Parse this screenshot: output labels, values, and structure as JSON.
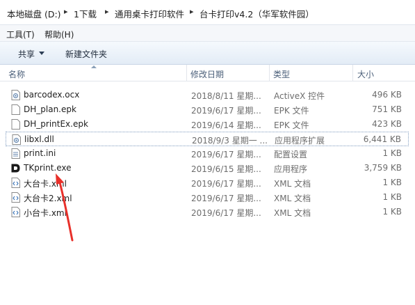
{
  "breadcrumb": [
    "本地磁盘 (D:)",
    "1下载",
    "通用桌卡打印软件",
    "台卡打印v4.2（华军软件园）"
  ],
  "menu": [
    "工具(T)",
    "帮助(H)"
  ],
  "toolbar": {
    "share_label": "共享",
    "new_folder_label": "新建文件夹"
  },
  "columns": {
    "name": "名称",
    "date": "修改日期",
    "type": "类型",
    "size": "大小"
  },
  "files": [
    {
      "icon": "settings-file-icon",
      "name": "barcodex.ocx",
      "date": "2018/8/11 星期...",
      "type": "ActiveX 控件",
      "size": "496 KB"
    },
    {
      "icon": "blank-file-icon",
      "name": "DH_plan.epk",
      "date": "2019/6/17 星期...",
      "type": "EPK 文件",
      "size": "751 KB"
    },
    {
      "icon": "blank-file-icon",
      "name": "DH_printEx.epk",
      "date": "2019/6/14 星期...",
      "type": "EPK 文件",
      "size": "423 KB"
    },
    {
      "icon": "settings-file-icon",
      "name": "libxl.dll",
      "date": "2018/9/3 星期一 ...",
      "type": "应用程序扩展",
      "size": "6,441 KB"
    },
    {
      "icon": "ini-file-icon",
      "name": "print.ini",
      "date": "2019/6/17 星期...",
      "type": "配置设置",
      "size": "1 KB"
    },
    {
      "icon": "app-d-logo-icon",
      "name": "TKprint.exe",
      "date": "2019/6/15 星期...",
      "type": "应用程序",
      "size": "3,759 KB"
    },
    {
      "icon": "xml-file-icon",
      "name": "大台卡.xml",
      "date": "2019/6/17 星期...",
      "type": "XML 文档",
      "size": "1 KB"
    },
    {
      "icon": "xml-file-icon",
      "name": "大台卡2.xml",
      "date": "2019/6/17 星期...",
      "type": "XML 文档",
      "size": "1 KB"
    },
    {
      "icon": "xml-file-icon",
      "name": "小台卡.xml",
      "date": "2019/6/17 星期...",
      "type": "XML 文档",
      "size": "1 KB"
    }
  ],
  "colors": {
    "annotation_arrow": "#e8302a",
    "toolbar_bg": "#e3ecf6",
    "selection_border": "#7f9bbf"
  }
}
